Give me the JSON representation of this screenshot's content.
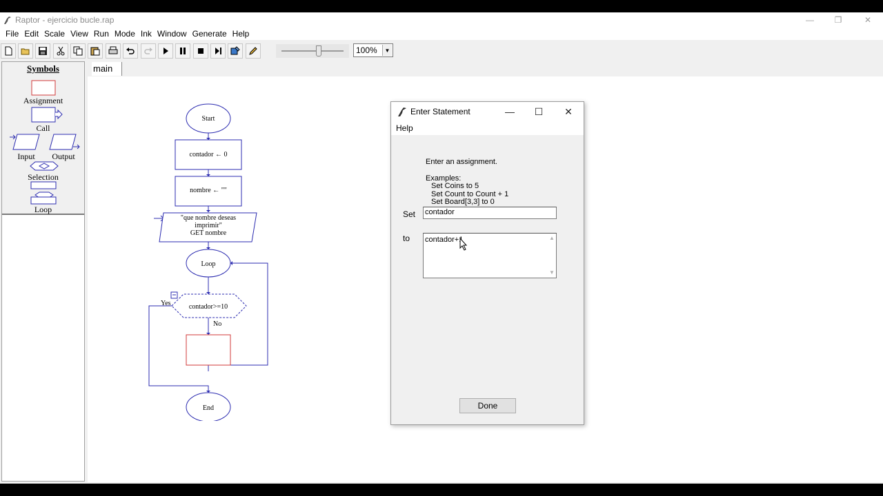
{
  "window": {
    "title": "Raptor - ejercicio bucle.rap",
    "controls": {
      "minimize": "—",
      "restore": "❐",
      "close": "✕"
    }
  },
  "menubar": [
    "File",
    "Edit",
    "Scale",
    "View",
    "Run",
    "Mode",
    "Ink",
    "Window",
    "Generate",
    "Help"
  ],
  "toolbar": {
    "buttons": [
      "new-icon",
      "open-icon",
      "save-icon",
      "cut-icon",
      "copy-icon",
      "paste-icon",
      "print-icon",
      "undo-icon",
      "redo-icon",
      "play-icon",
      "pause-icon",
      "stop-icon",
      "step-icon",
      "debug-icon",
      "pen-icon"
    ],
    "zoom": "100%"
  },
  "symbols": {
    "heading": "Symbols",
    "items": [
      "Assignment",
      "Call",
      "Input",
      "Output",
      "Selection",
      "Loop"
    ]
  },
  "tabs": [
    "main"
  ],
  "flowchart": {
    "start": "Start",
    "assign1": "contador ← 0",
    "assign2": "nombre ← \"\"",
    "input_prompt_line1": "\"que nombre deseas",
    "input_prompt_line2": "imprimir\"",
    "input_get": "GET nombre",
    "loop": "Loop",
    "condition": "contador>=10",
    "yes": "Yes",
    "no": "No",
    "end": "End"
  },
  "dialog": {
    "title": "Enter Statement",
    "menu": "Help",
    "instruction": "Enter an assignment.",
    "examples_heading": "Examples:",
    "examples": [
      "Set Coins to 5",
      "Set Count to Count + 1",
      "Set Board[3,3] to 0"
    ],
    "set_label": "Set",
    "set_value": "contador",
    "to_label": "to",
    "to_value": "contador+1",
    "done_label": "Done"
  },
  "colors": {
    "flow_blue": "#2b2bb0",
    "assignment_red": "#d23a3a"
  }
}
